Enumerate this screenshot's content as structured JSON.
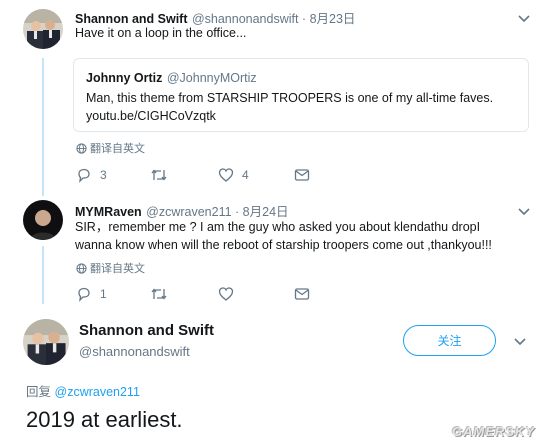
{
  "tweet1": {
    "display_name": "Shannon and Swift",
    "handle_time": "@shannonandswift · 8月23日",
    "text": "Have it on a loop in the office...",
    "quote": {
      "display_name": "Johnny Ortiz",
      "handle": "@JohnnyMOrtiz",
      "text": "Man, this theme from STARSHIP TROOPERS is one of my all-time faves.",
      "link": "youtu.be/CIGHCoVzqtk"
    },
    "translate_label": "翻译自英文",
    "actions": {
      "reply_count": "3",
      "retweet_count": "",
      "like_count": "4"
    }
  },
  "tweet2": {
    "display_name": "MYMRaven",
    "handle_time": "@zcwraven211 · 8月24日",
    "text_line1": "SIR，remember me ? I am the guy who asked you about klendathu dropI",
    "text_line2": "wanna know when will the reboot of starship troopers come out ,thankyou!!!",
    "translate_label": "翻译自英文",
    "actions": {
      "reply_count": "1",
      "retweet_count": "",
      "like_count": ""
    }
  },
  "main_tweet": {
    "display_name": "Shannon and Swift",
    "handle": "@shannonandswift",
    "follow_label": "关注",
    "reply_prefix": "回复",
    "reply_handle": "@zcwraven211",
    "text": "2019 at earliest."
  },
  "watermark": "GAMERSKY",
  "colors": {
    "accent": "#1da1f2",
    "thread_line": "#c4e4f8",
    "muted": "#657786"
  },
  "icons": [
    "chevron-down-icon",
    "globe-icon",
    "reply-icon",
    "retweet-icon",
    "like-icon",
    "message-icon"
  ]
}
